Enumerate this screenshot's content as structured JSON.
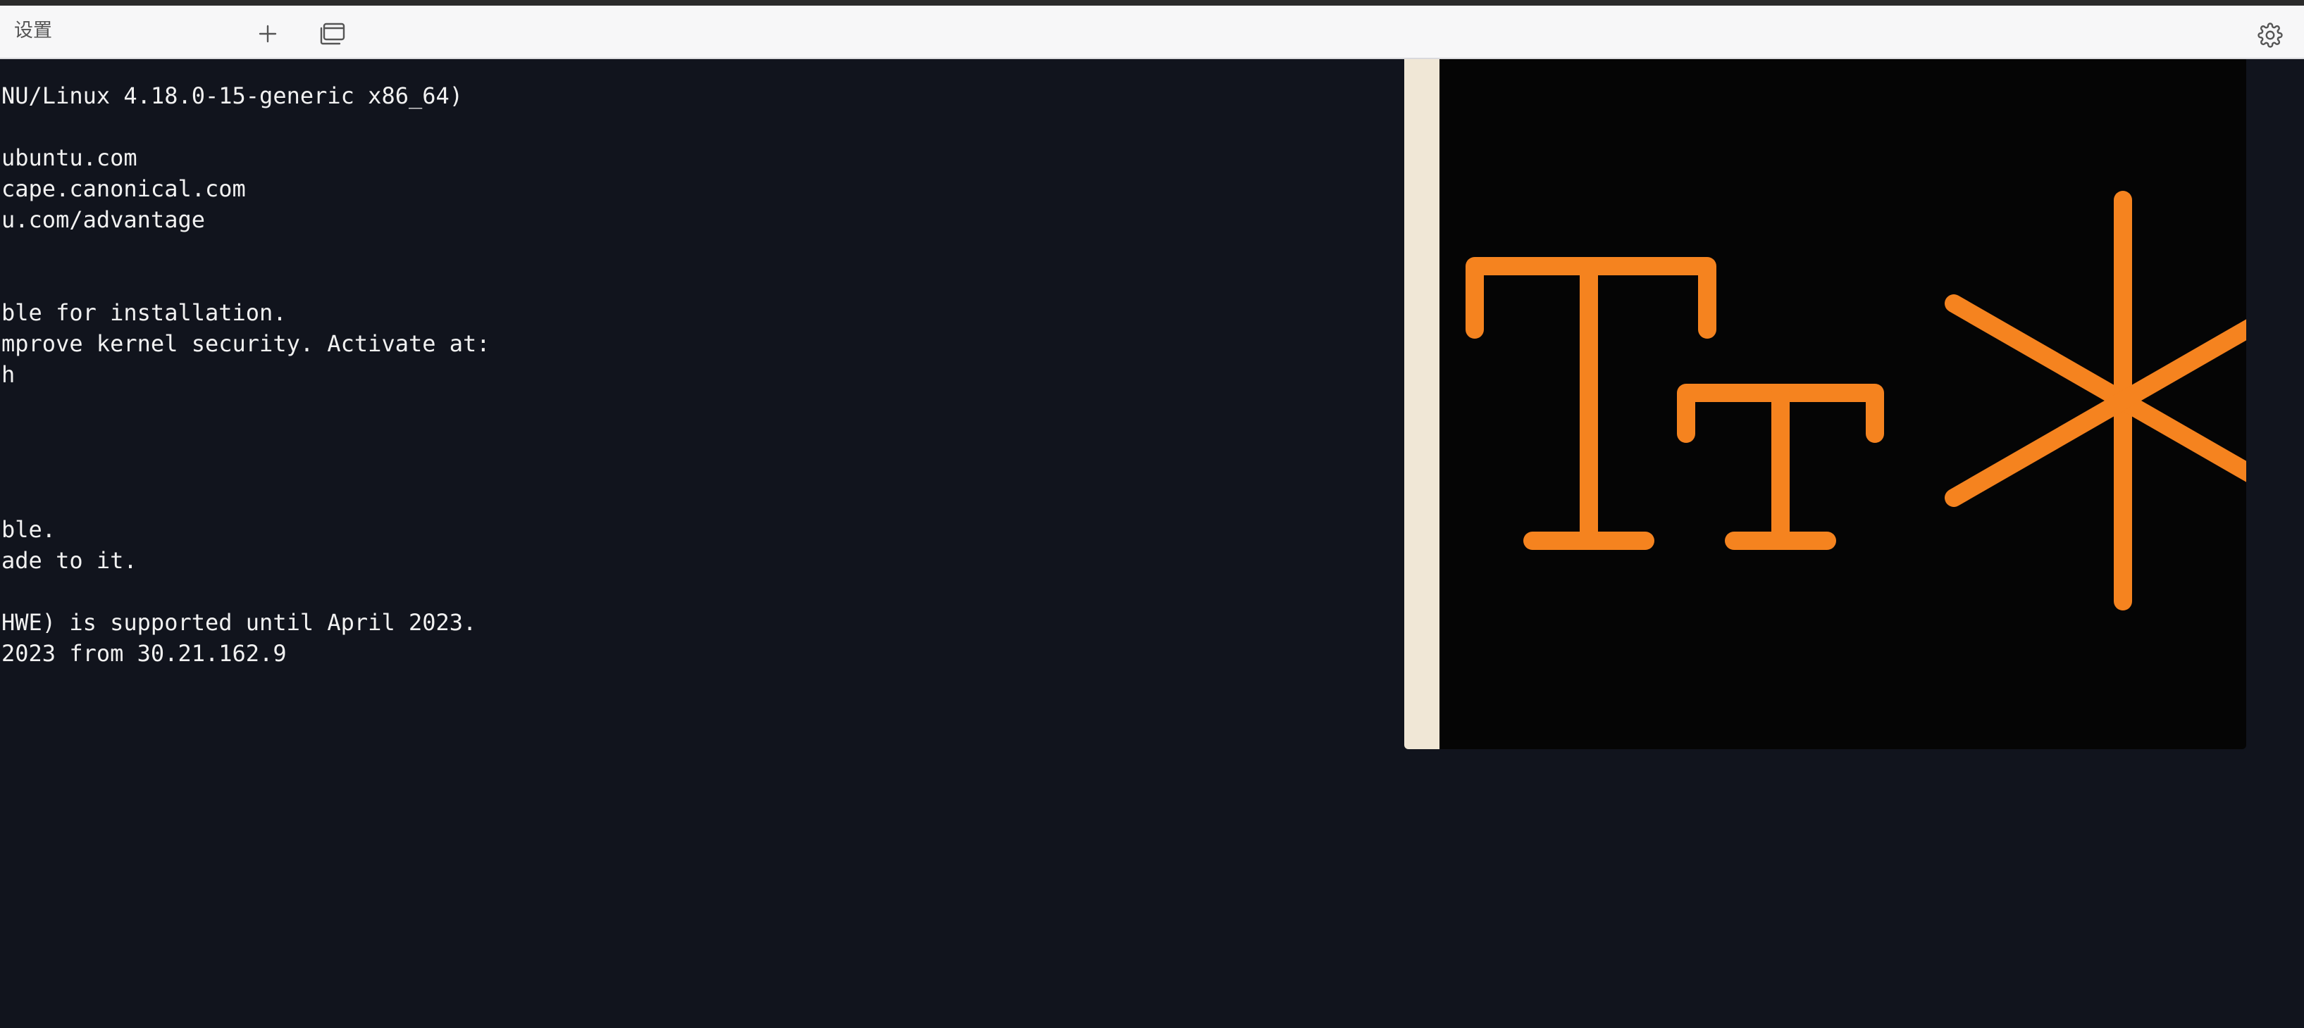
{
  "tab_bar": {
    "title": "设置",
    "new_tab_icon": "plus-icon",
    "windows_icon": "windows-icon",
    "settings_icon": "gear-icon"
  },
  "terminal": {
    "lines": [
      "NU/Linux 4.18.0-15-generic x86_64)",
      "",
      "ubuntu.com",
      "cape.canonical.com",
      "u.com/advantage",
      "",
      "",
      "ble for installation.",
      "mprove kernel security. Activate at:",
      "h",
      "",
      "",
      "",
      "",
      "ble.",
      "ade to it.",
      "",
      "HWE) is supported until April 2023.",
      "2023 from 30.21.162.9"
    ]
  },
  "preview": {
    "icon": "font-size-icon",
    "accent_color": "#f5831f",
    "background_color": "#050505",
    "strip_color": "#f0e7d6"
  }
}
